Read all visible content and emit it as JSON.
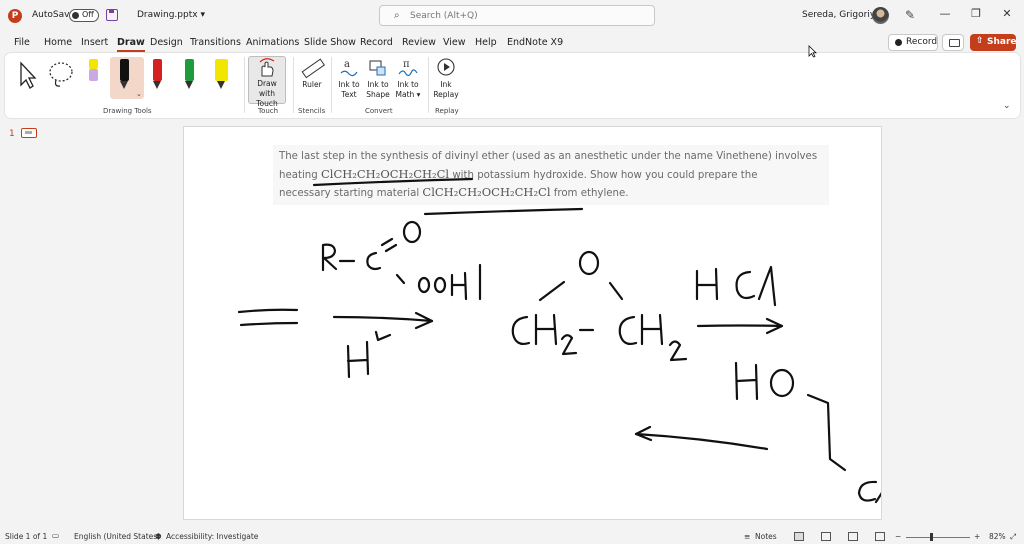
{
  "titlebar": {
    "app_logo": "P",
    "autosave_label": "AutoSave",
    "autosave_state": "Off",
    "filename": "Drawing.pptx",
    "filename_chevron": "▾",
    "search_placeholder": "Search (Alt+Q)",
    "user_name": "Sereda, Grigoriy A",
    "win_minimize": "—",
    "win_restore": "❐",
    "win_close": "✕"
  },
  "menu": {
    "tabs": [
      {
        "label": "File"
      },
      {
        "label": "Home"
      },
      {
        "label": "Insert"
      },
      {
        "label": "Draw",
        "active": true
      },
      {
        "label": "Design"
      },
      {
        "label": "Transitions"
      },
      {
        "label": "Animations"
      },
      {
        "label": "Slide Show"
      },
      {
        "label": "Record"
      },
      {
        "label": "Review"
      },
      {
        "label": "View"
      },
      {
        "label": "Help"
      },
      {
        "label": "EndNote X9"
      }
    ],
    "record_button": "Record",
    "share_button": "Share"
  },
  "ribbon": {
    "groups": {
      "drawing_tools": "Drawing Tools",
      "touch": "Touch",
      "stencils": "Stencils",
      "convert": "Convert",
      "replay": "Replay"
    },
    "buttons": {
      "draw_with_touch_1": "Draw with",
      "draw_with_touch_2": "Touch",
      "ruler": "Ruler",
      "ink_to_text_1": "Ink to",
      "ink_to_text_2": "Text",
      "ink_to_shape_1": "Ink to",
      "ink_to_shape_2": "Shape",
      "ink_to_math_1": "Ink to",
      "ink_to_math_2": "Math ▾",
      "ink_replay_1": "Ink",
      "ink_replay_2": "Replay"
    },
    "pens": [
      {
        "name": "pen-lilac-yellow",
        "color": "#c9a9e6"
      },
      {
        "name": "pen-black",
        "color": "#111111",
        "selected": true
      },
      {
        "name": "pen-red",
        "color": "#d62020"
      },
      {
        "name": "pen-green",
        "color": "#1e9b3c"
      },
      {
        "name": "highlighter-yellow",
        "color": "#f2e600"
      }
    ]
  },
  "thumbnails": {
    "slide_number": "1"
  },
  "slide": {
    "problem_1": "The last step in the synthesis of divinyl ether (used as an anesthetic under the name Vinethene) involves",
    "problem_2a": "heating ",
    "formula_1": "ClCH₂CH₂OCH₂CH₂Cl",
    "problem_2b": " with potassium hydroxide. Show how you could prepare the",
    "problem_3a": "necessary starting material ",
    "formula_2": "ClCH₂CH₂OCH₂CH₂Cl",
    "problem_3b": " from ethylene."
  },
  "statusbar": {
    "slide_of": "Slide 1 of 1",
    "language": "English (United States)",
    "accessibility": "Accessibility: Investigate",
    "notes": "Notes",
    "zoom_minus": "−",
    "zoom_plus": "+",
    "zoom_level": "82%"
  }
}
